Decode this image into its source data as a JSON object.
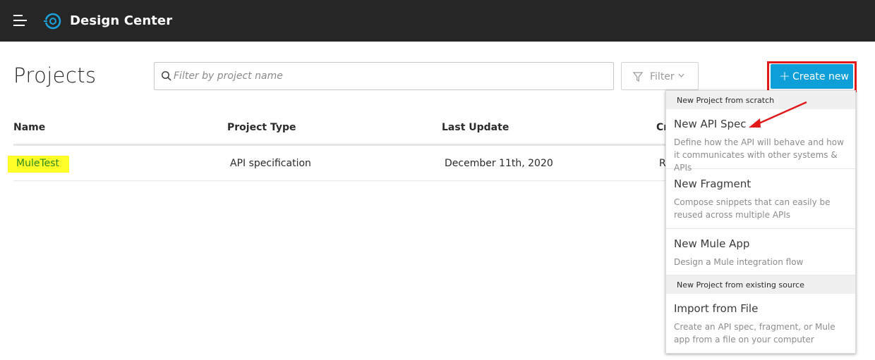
{
  "app": {
    "title": "Design Center"
  },
  "page": {
    "title": "Projects"
  },
  "search": {
    "placeholder": "Filter by project name"
  },
  "filter": {
    "label": "Filter"
  },
  "create": {
    "label": "Create new",
    "plus": "+"
  },
  "table": {
    "headers": [
      "Name",
      "Project Type",
      "Last Update",
      "Cr"
    ],
    "rows": [
      {
        "name": "MuleTest",
        "type": "API specification",
        "last_update": "December 11th, 2020",
        "created": "R"
      }
    ]
  },
  "menu": {
    "sections": [
      "New Project from scratch",
      "New Project from existing source"
    ],
    "items": [
      {
        "title": "New API Spec",
        "desc": "Define how the API will behave and how it communicates with other systems & APIs"
      },
      {
        "title": "New Fragment",
        "desc": "Compose snippets that can easily be reused across multiple APIs"
      },
      {
        "title": "New Mule App",
        "desc": "Design a Mule integration flow"
      },
      {
        "title": "Import from File",
        "desc": "Create an API spec, fragment, or Mule app from a file on your computer"
      }
    ]
  },
  "colors": {
    "topbar": "#262626",
    "accent": "#0f9fd8",
    "highlight": "#ffff27",
    "annotation_red": "#e0191b"
  }
}
